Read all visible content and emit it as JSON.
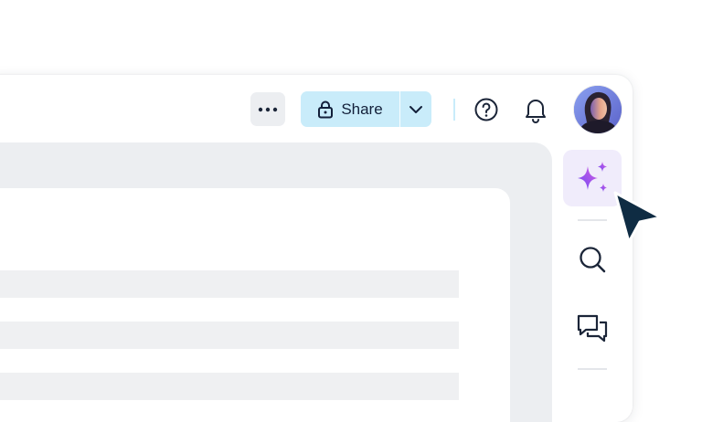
{
  "toolbar": {
    "more_icon": "ellipsis-icon",
    "share_label": "Share",
    "share_icon": "lock-icon",
    "share_menu_icon": "chevron-down-icon",
    "help_icon": "question-circle-icon",
    "notifications_icon": "bell-icon",
    "avatar_icon": "user-avatar"
  },
  "right_sidebar": {
    "items": [
      {
        "icon": "sparkles-icon",
        "active": true
      },
      {
        "icon": "search-icon",
        "active": false
      },
      {
        "icon": "chat-bubbles-icon",
        "active": false
      }
    ]
  },
  "colors": {
    "share_bg": "#c9ecfa",
    "ai_bg": "#f0ecfb",
    "sparkle_gradient": [
      "#6b4cf6",
      "#d75ce0"
    ],
    "cursor": "#0f2c43",
    "content_bg": "#eceef1"
  },
  "pointer_icon": "mouse-cursor-icon"
}
